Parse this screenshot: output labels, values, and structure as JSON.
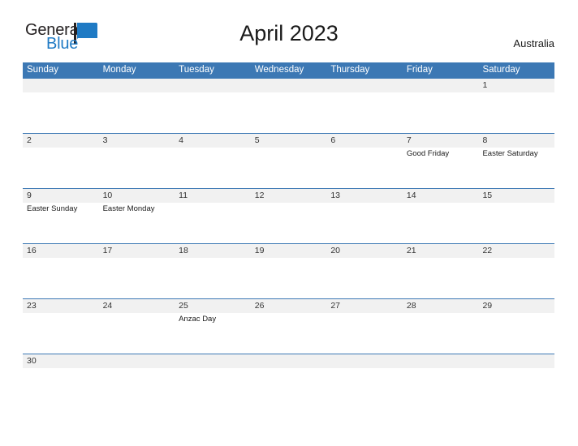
{
  "brand": {
    "word_one": "General",
    "word_two": "Blue",
    "flag_icon": "blue-flag-triangle-icon",
    "dark_color": "#231f20",
    "blue_color": "#1f7ac4"
  },
  "header": {
    "title": "April 2023",
    "region": "Australia"
  },
  "theme": {
    "header_blue": "#3c78b4",
    "daynum_band": "#f1f1f1",
    "cell_background": "#ffffff",
    "text_color": "#1a1a1a"
  },
  "calendar": {
    "month": "April",
    "year": "2023",
    "weekdays": [
      "Sunday",
      "Monday",
      "Tuesday",
      "Wednesday",
      "Thursday",
      "Friday",
      "Saturday"
    ],
    "weeks": [
      {
        "days": [
          {
            "number": "",
            "event": ""
          },
          {
            "number": "",
            "event": ""
          },
          {
            "number": "",
            "event": ""
          },
          {
            "number": "",
            "event": ""
          },
          {
            "number": "",
            "event": ""
          },
          {
            "number": "",
            "event": ""
          },
          {
            "number": "1",
            "event": ""
          }
        ]
      },
      {
        "days": [
          {
            "number": "2",
            "event": ""
          },
          {
            "number": "3",
            "event": ""
          },
          {
            "number": "4",
            "event": ""
          },
          {
            "number": "5",
            "event": ""
          },
          {
            "number": "6",
            "event": ""
          },
          {
            "number": "7",
            "event": "Good Friday"
          },
          {
            "number": "8",
            "event": "Easter Saturday"
          }
        ]
      },
      {
        "days": [
          {
            "number": "9",
            "event": "Easter Sunday"
          },
          {
            "number": "10",
            "event": "Easter Monday"
          },
          {
            "number": "11",
            "event": ""
          },
          {
            "number": "12",
            "event": ""
          },
          {
            "number": "13",
            "event": ""
          },
          {
            "number": "14",
            "event": ""
          },
          {
            "number": "15",
            "event": ""
          }
        ]
      },
      {
        "days": [
          {
            "number": "16",
            "event": ""
          },
          {
            "number": "17",
            "event": ""
          },
          {
            "number": "18",
            "event": ""
          },
          {
            "number": "19",
            "event": ""
          },
          {
            "number": "20",
            "event": ""
          },
          {
            "number": "21",
            "event": ""
          },
          {
            "number": "22",
            "event": ""
          }
        ]
      },
      {
        "days": [
          {
            "number": "23",
            "event": ""
          },
          {
            "number": "24",
            "event": ""
          },
          {
            "number": "25",
            "event": "Anzac Day"
          },
          {
            "number": "26",
            "event": ""
          },
          {
            "number": "27",
            "event": ""
          },
          {
            "number": "28",
            "event": ""
          },
          {
            "number": "29",
            "event": ""
          }
        ]
      },
      {
        "truncated": true,
        "days": [
          {
            "number": "30",
            "event": ""
          },
          {
            "number": "",
            "event": ""
          },
          {
            "number": "",
            "event": ""
          },
          {
            "number": "",
            "event": ""
          },
          {
            "number": "",
            "event": ""
          },
          {
            "number": "",
            "event": ""
          },
          {
            "number": "",
            "event": ""
          }
        ]
      }
    ]
  }
}
